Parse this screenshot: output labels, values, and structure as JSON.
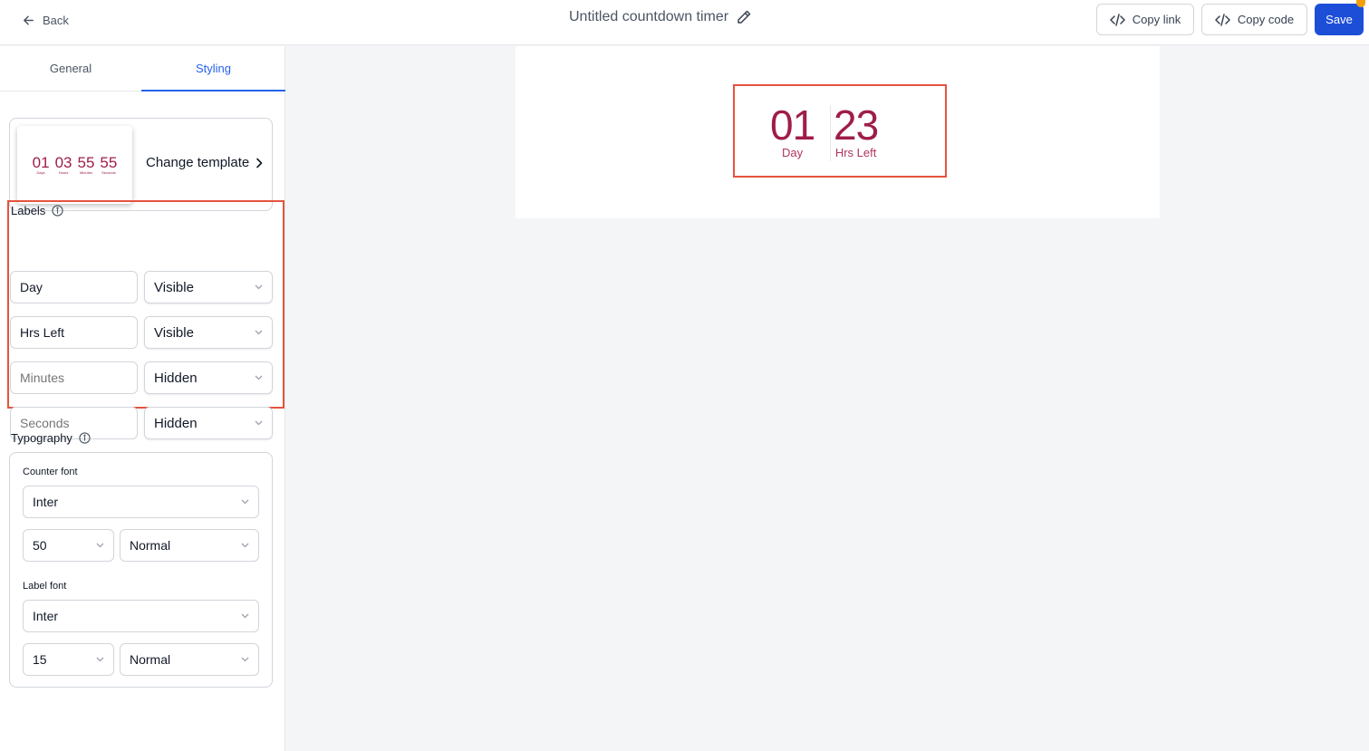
{
  "header": {
    "back_label": "Back",
    "title": "Untitled countdown timer",
    "copy_link_label": "Copy link",
    "copy_code_label": "Copy code",
    "save_label": "Save"
  },
  "tabs": [
    {
      "label": "General",
      "active": false
    },
    {
      "label": "Styling",
      "active": true
    }
  ],
  "template": {
    "change_label": "Change template",
    "preview": [
      {
        "value": "01",
        "label": "Days"
      },
      {
        "value": "03",
        "label": "Hours"
      },
      {
        "value": "55",
        "label": "Minutes"
      },
      {
        "value": "55",
        "label": "Seconds"
      }
    ]
  },
  "labels_section": {
    "title": "Labels",
    "rows": [
      {
        "value": "Day",
        "placeholder": "",
        "visibility": "Visible"
      },
      {
        "value": "Hrs Left",
        "placeholder": "",
        "visibility": "Visible"
      },
      {
        "value": "",
        "placeholder": "Minutes",
        "visibility": "Hidden"
      },
      {
        "value": "",
        "placeholder": "Seconds",
        "visibility": "Hidden"
      }
    ]
  },
  "typography": {
    "title": "Typography",
    "counter_font_label": "Counter font",
    "counter_font": "Inter",
    "counter_size": "50",
    "counter_weight": "Normal",
    "label_font_label": "Label font",
    "label_font": "Inter",
    "label_size": "15",
    "label_weight": "Normal"
  },
  "timer": {
    "units": [
      {
        "value": "01",
        "label": "Day"
      },
      {
        "value": "23",
        "label": "Hrs Left"
      }
    ]
  },
  "colors": {
    "accent": "#2563eb",
    "save": "#1d4ed8",
    "counter": "#9f1d4a",
    "highlight": "#e5533d"
  }
}
